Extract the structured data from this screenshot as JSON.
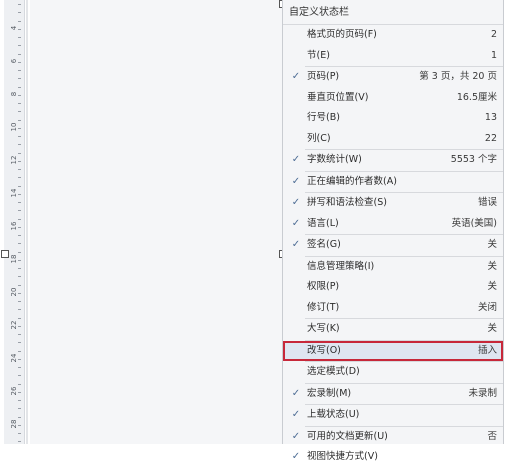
{
  "ruler": {
    "numbers": [
      "4",
      "6",
      "8",
      "10",
      "12",
      "14",
      "16",
      "18",
      "20",
      "22",
      "24",
      "26",
      "28"
    ]
  },
  "menu": {
    "title": "自定义状态栏",
    "items": [
      {
        "label": "格式页的页码(F)",
        "value": "2",
        "checked": false
      },
      {
        "label": "节(E)",
        "value": "1",
        "checked": false
      },
      {
        "label": "页码(P)",
        "value": "第 3 页，共 20 页",
        "checked": true
      },
      {
        "label": "垂直页位置(V)",
        "value": "16.5厘米",
        "checked": false
      },
      {
        "label": "行号(B)",
        "value": "13",
        "checked": false
      },
      {
        "label": "列(C)",
        "value": "22",
        "checked": false
      },
      {
        "label": "字数统计(W)",
        "value": "5553 个字",
        "checked": true
      },
      {
        "label": "正在编辑的作者数(A)",
        "value": "",
        "checked": true
      },
      {
        "label": "拼写和语法检查(S)",
        "value": "错误",
        "checked": true
      },
      {
        "label": "语言(L)",
        "value": "英语(美国)",
        "checked": true
      },
      {
        "label": "签名(G)",
        "value": "关",
        "checked": true
      },
      {
        "label": "信息管理策略(I)",
        "value": "关",
        "checked": false
      },
      {
        "label": "权限(P)",
        "value": "关",
        "checked": false
      },
      {
        "label": "修订(T)",
        "value": "关闭",
        "checked": false
      },
      {
        "label": "大写(K)",
        "value": "关",
        "checked": false
      },
      {
        "label": "改写(O)",
        "value": "插入",
        "checked": false,
        "highlighted": true
      },
      {
        "label": "选定模式(D)",
        "value": "",
        "checked": false
      },
      {
        "label": "宏录制(M)",
        "value": "未录制",
        "checked": true
      },
      {
        "label": "上载状态(U)",
        "value": "",
        "checked": true
      },
      {
        "label": "可用的文档更新(U)",
        "value": "否",
        "checked": true
      },
      {
        "label": "视图快捷方式(V)",
        "value": "",
        "checked": true
      }
    ],
    "check_glyph": "✓",
    "separators_after": [
      1,
      5,
      6,
      7,
      9,
      10,
      13,
      14,
      15,
      16,
      17,
      18
    ]
  }
}
